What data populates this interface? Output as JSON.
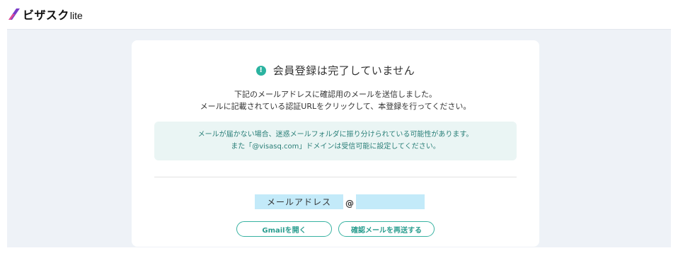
{
  "header": {
    "logo_main": "ビザスク",
    "logo_sub": "lite"
  },
  "notice": {
    "icon": "exclamation-icon",
    "title": "会員登録は完了していません"
  },
  "description": {
    "line1": "下記のメールアドレスに確認用のメールを送信しました。",
    "line2": "メールに記載されている認証URLをクリックして、本登録を行ってください。"
  },
  "info": {
    "line1": "メールが届かない場合、迷惑メールフォルダに振り分けられている可能性があります。",
    "line2": "また「@visasq.com」ドメインは受信可能に設定してください。"
  },
  "email": {
    "local": "メールアドレス",
    "at": "@"
  },
  "buttons": {
    "gmail": "Gmailを開く",
    "resend": "確認メールを再送する"
  },
  "colors": {
    "accent": "#2bb3a0",
    "info_bg": "#eaf5f4",
    "page_bg": "#eef2f7",
    "mask": "#c3eaf9"
  }
}
